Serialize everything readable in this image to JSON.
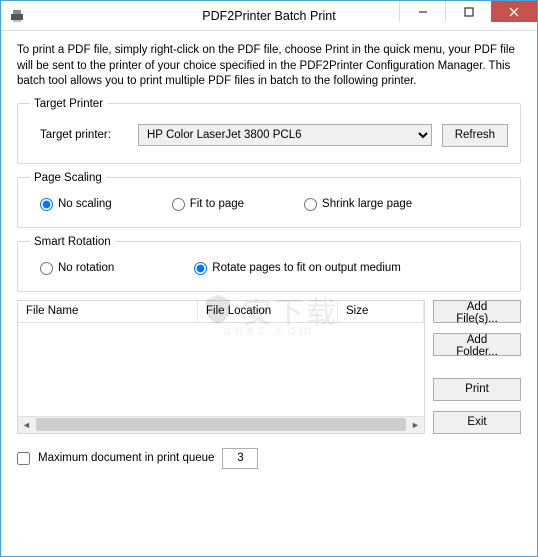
{
  "window": {
    "title": "PDF2Printer Batch Print"
  },
  "intro": "To print a PDF file, simply right-click on the PDF file, choose Print in the quick menu, your PDF file will be sent to the printer of your choice specified in the PDF2Printer Configuration Manager. This batch tool allows you to print multiple PDF files in batch to the following printer.",
  "target_printer": {
    "legend": "Target Printer",
    "label": "Target printer:",
    "selected": "HP Color LaserJet 3800 PCL6",
    "refresh": "Refresh"
  },
  "page_scaling": {
    "legend": "Page Scaling",
    "options": {
      "none": "No scaling",
      "fit": "Fit to page",
      "shrink": "Shrink large page"
    },
    "selected": "none"
  },
  "smart_rotation": {
    "legend": "Smart Rotation",
    "options": {
      "none": "No rotation",
      "fit": "Rotate pages to fit on output medium"
    },
    "selected": "fit"
  },
  "table": {
    "cols": {
      "filename": "File Name",
      "location": "File Location",
      "size": "Size"
    }
  },
  "buttons": {
    "add_files": "Add File(s)...",
    "add_folder": "Add Folder...",
    "print": "Print",
    "exit": "Exit"
  },
  "footer": {
    "max_label": "Maximum document in print queue",
    "max_value": "3"
  },
  "watermark": {
    "text": "安下载",
    "sub": "anxz.com"
  }
}
